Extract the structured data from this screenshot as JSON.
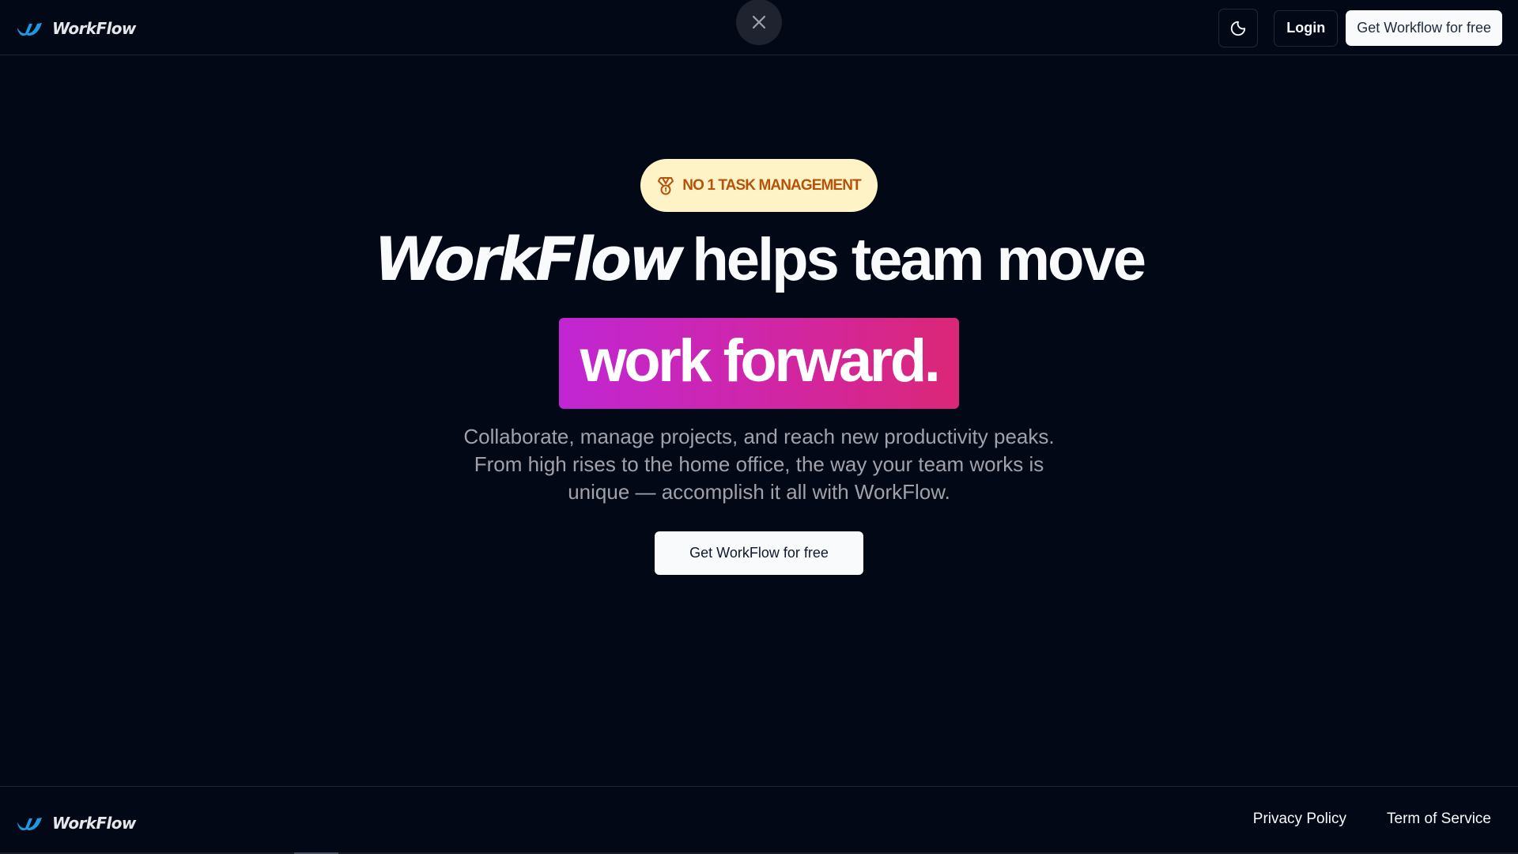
{
  "header": {
    "brand_name": "WorkFlow",
    "logo_icon": "workflow-w-logo",
    "close_icon": "close-x-icon",
    "theme_icon": "moon-icon",
    "login_label": "Login",
    "cta_label": "Get Workflow for free"
  },
  "hero": {
    "badge_icon": "medal-icon",
    "badge_text": "NO 1 TASK MANAGEMENT",
    "headline_brand": "WorkFlow",
    "headline_rest": "helps team move",
    "highlight": "work forward.",
    "description_lines": [
      "Collaborate, manage projects, and reach new productivity peaks.",
      "From high rises to the home office, the way your team works is",
      "unique — accomplish it all with WorkFlow."
    ],
    "cta_label": "Get WorkFlow for free"
  },
  "footer": {
    "brand_name": "WorkFlow",
    "links": [
      {
        "label": "Privacy Policy"
      },
      {
        "label": "Term of Service"
      }
    ]
  },
  "colors": {
    "background": "#030817",
    "accent_blue": "#1e9be0",
    "badge_bg": "#fef3c7",
    "badge_text": "#b45309",
    "gradient_start": "#c026d3",
    "gradient_end": "#db2777"
  }
}
